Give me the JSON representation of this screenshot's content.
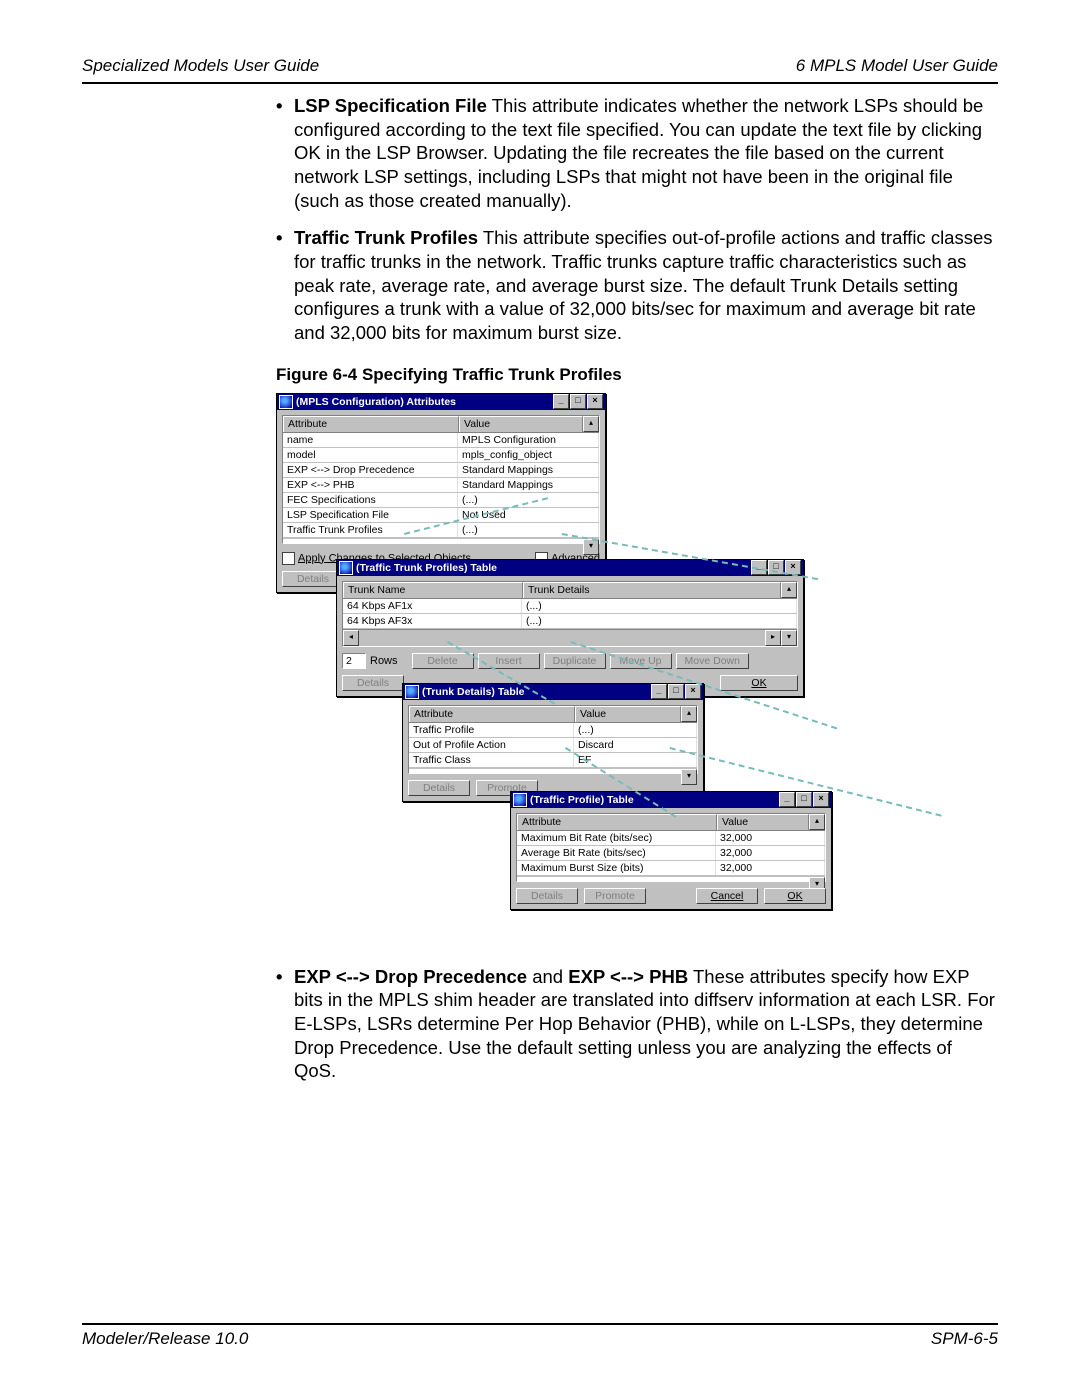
{
  "header": {
    "left": "Specialized Models User Guide",
    "right": "6   MPLS Model User Guide"
  },
  "footer": {
    "left": "Modeler/Release 10.0",
    "right": "SPM-6-5"
  },
  "bullets": {
    "lsp_specfile": {
      "title": "LSP Specification File",
      "body": " This attribute indicates whether the network LSPs should be configured according to the text file specified. You can update the text file by clicking OK in the LSP Browser. Updating the file recreates the file based on the current network LSP settings, including LSPs that might not have been in the original file (such as those created manually)."
    },
    "traffic_trunk": {
      "title": "Traffic Trunk Profiles",
      "body": " This attribute specifies out-of-profile actions and traffic classes for traffic trunks in the network. Traffic trunks capture traffic characteristics such as peak rate, average rate, and average burst size. The default Trunk Details setting configures a trunk with a value of 32,000 bits/sec for maximum and average bit rate and 32,000 bits for maximum burst size."
    },
    "exp": {
      "title1": "EXP <--> Drop Precedence",
      "mid": " and ",
      "title2": "EXP <--> PHB",
      "body": " These attributes specify how EXP bits in the MPLS shim header are translated into diffserv information at each LSR. For E-LSPs, LSRs determine Per Hop Behavior (PHB), while on L-LSPs, they determine Drop Precedence. Use the default setting unless you are analyzing the effects of QoS."
    }
  },
  "figure_caption": "Figure 6-4   Specifying Traffic Trunk Profiles",
  "win_mpls": {
    "title": "(MPLS Configuration) Attributes",
    "cols": {
      "attr": "Attribute",
      "val": "Value"
    },
    "rows": [
      {
        "a": "name",
        "v": "MPLS Configuration"
      },
      {
        "a": "model",
        "v": "mpls_config_object"
      },
      {
        "a": "EXP <--> Drop Precedence",
        "v": "Standard Mappings"
      },
      {
        "a": "EXP <--> PHB",
        "v": "Standard Mappings"
      },
      {
        "a": "FEC Specifications",
        "v": "(...)"
      },
      {
        "a": "LSP Specification File",
        "v": "Not Used"
      },
      {
        "a": "Traffic Trunk Profiles",
        "v": "(...)"
      }
    ],
    "apply_changes": "Apply Changes to Selected Objects",
    "advanced": "Advanced",
    "details": "Details"
  },
  "win_trunk_profiles": {
    "title": "(Traffic Trunk Profiles) Table",
    "cols": {
      "name": "Trunk Name",
      "details": "Trunk Details"
    },
    "rows": [
      {
        "n": "64 Kbps AF1x",
        "d": "(...)"
      },
      {
        "n": "64 Kbps AF3x",
        "d": "(...)"
      }
    ],
    "rows_count": "2",
    "rows_label": "Rows",
    "buttons": {
      "delete": "Delete",
      "insert": "Insert",
      "duplicate": "Duplicate",
      "moveup": "Move Up",
      "movedown": "Move Down",
      "details": "Details",
      "ok": "OK"
    }
  },
  "win_trunk_details": {
    "title": "(Trunk Details) Table",
    "cols": {
      "attr": "Attribute",
      "val": "Value"
    },
    "rows": [
      {
        "a": "Traffic Profile",
        "v": "(...)"
      },
      {
        "a": "Out of Profile Action",
        "v": "Discard"
      },
      {
        "a": "Traffic Class",
        "v": "EF"
      }
    ],
    "buttons": {
      "details": "Details",
      "promote": "Promote"
    }
  },
  "win_traffic_profile": {
    "title": "(Traffic Profile) Table",
    "cols": {
      "attr": "Attribute",
      "val": "Value"
    },
    "rows": [
      {
        "a": "Maximum Bit Rate (bits/sec)",
        "v": "32,000"
      },
      {
        "a": "Average Bit Rate (bits/sec)",
        "v": "32,000"
      },
      {
        "a": "Maximum Burst Size (bits)",
        "v": "32,000"
      }
    ],
    "buttons": {
      "details": "Details",
      "promote": "Promote",
      "cancel": "Cancel",
      "ok": "OK"
    }
  }
}
